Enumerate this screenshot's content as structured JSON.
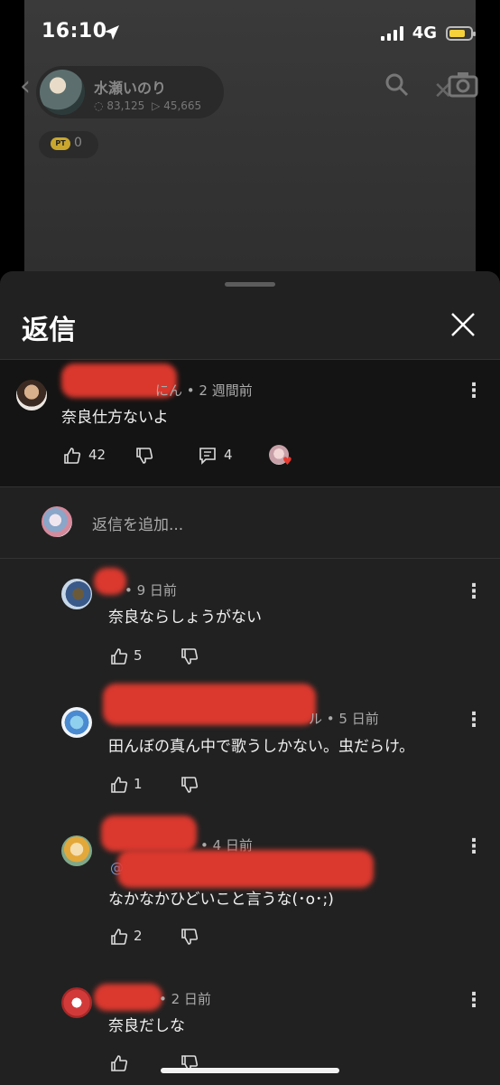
{
  "status_bar": {
    "time": "16:10",
    "network": "4G"
  },
  "background_page": {
    "creator_name": "水瀬いのり",
    "comments_count": "83,125",
    "views_count": "45,665",
    "pt_label": "PT",
    "pt_value": "0"
  },
  "sheet": {
    "title": "返信",
    "add_reply_placeholder": "返信を追加..."
  },
  "parent_comment": {
    "author_suffix": "にん",
    "time": "2 週間前",
    "text": "奈良仕方ないよ",
    "likes": "42",
    "reply_count": "4"
  },
  "replies": [
    {
      "time": "9 日前",
      "text": "奈良ならしょうがない",
      "likes": "5"
    },
    {
      "author_suffix": "ル",
      "time": "5 日前",
      "text": "田んぼの真ん中で歌うしかない。虫だらけ。",
      "likes": "1"
    },
    {
      "time": "4 日前",
      "mention": "@",
      "text": "なかなかひどいこと言うな(･o･;)",
      "likes": "2"
    },
    {
      "time": "2 日前",
      "text": "奈良だしな",
      "likes": ""
    }
  ],
  "colors": {
    "sheet_bg": "#212121",
    "parent_bg": "#141414",
    "battery": "#f5d23c",
    "redaction": "#e53a2f"
  }
}
